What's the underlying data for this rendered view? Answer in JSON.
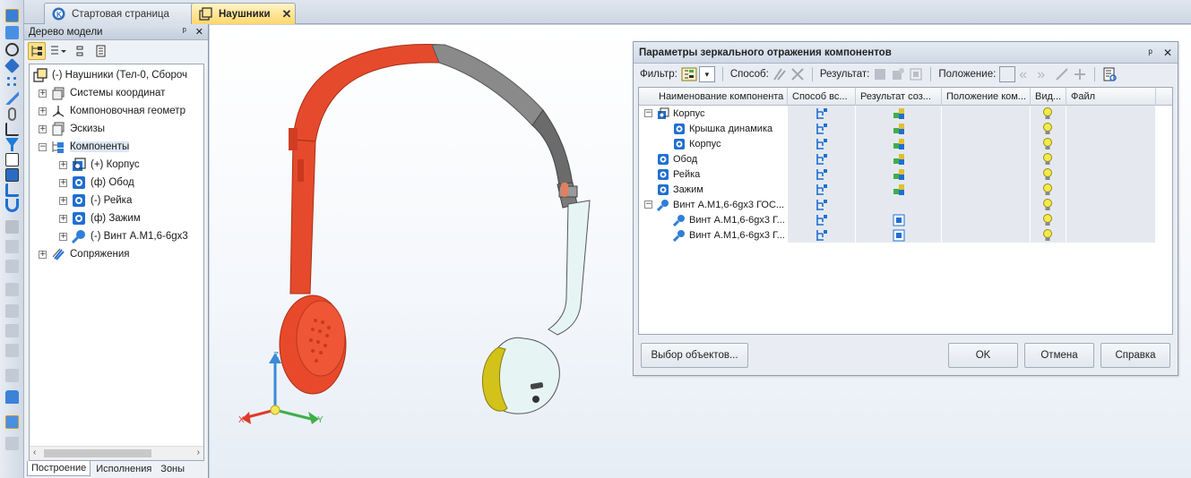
{
  "tabs": [
    {
      "label": "Стартовая страница",
      "icon": "kompas-logo-icon",
      "active": false
    },
    {
      "label": "Наушники",
      "icon": "assembly-icon",
      "active": true,
      "close": "✕"
    }
  ],
  "tree_panel": {
    "title": "Дерево модели",
    "pin": "ᵖ",
    "close": "✕",
    "nodes": [
      {
        "label": "(-) Наушники (Тел-0, Сбороч",
        "icon": "assembly-icon",
        "expander": ""
      },
      {
        "label": "Системы координат",
        "icon": "coordinate-systems-icon",
        "expander": "+"
      },
      {
        "label": "Компоновочная геометр",
        "icon": "layout-geometry-icon",
        "expander": "+"
      },
      {
        "label": "Эскизы",
        "icon": "sketches-icon",
        "expander": "+"
      },
      {
        "label": "Компоненты",
        "icon": "components-icon",
        "expander": "−"
      },
      {
        "label": "(+) Корпус",
        "icon": "subassembly-icon",
        "expander": "+"
      },
      {
        "label": "(ф) Обод",
        "icon": "part-icon",
        "expander": "+"
      },
      {
        "label": "(-) Рейка",
        "icon": "part-icon",
        "expander": "+"
      },
      {
        "label": "(ф) Зажим",
        "icon": "part-icon",
        "expander": "+"
      },
      {
        "label": "(-) Винт А.М1,6-6gx3",
        "icon": "screw-icon",
        "expander": "+"
      },
      {
        "label": "Сопряжения",
        "icon": "mates-icon",
        "expander": "+"
      }
    ],
    "bottom_tabs": [
      "Построение",
      "Исполнения",
      "Зоны"
    ]
  },
  "axes": {
    "x": "X",
    "y": "Y",
    "z": "Z"
  },
  "dialog": {
    "title": "Параметры зеркального отражения компонентов",
    "pin": "ᵖ",
    "close": "✕",
    "filter_label": "Фильтр:",
    "method_label": "Способ:",
    "result_label": "Результат:",
    "position_label": "Положение:",
    "columns": [
      "Наименование компонента",
      "Способ вс...",
      "Результат соз...",
      "Положение ком...",
      "Вид...",
      "Файл"
    ],
    "rows": [
      {
        "name": "Корпус",
        "expander": "−",
        "indent": 0,
        "icon": "subassembly-icon",
        "result_icon": "mirror-copy-icon"
      },
      {
        "name": "Крышка динамика",
        "expander": "",
        "indent": 1,
        "icon": "part-icon",
        "result_icon": "mirror-copy-icon"
      },
      {
        "name": "Корпус",
        "expander": "",
        "indent": 1,
        "icon": "part-icon",
        "result_icon": "mirror-copy-icon"
      },
      {
        "name": "Обод",
        "expander": "",
        "indent": 0,
        "icon": "part-icon",
        "result_icon": "mirror-copy-icon"
      },
      {
        "name": "Рейка",
        "expander": "",
        "indent": 0,
        "icon": "part-icon",
        "result_icon": "mirror-copy-icon"
      },
      {
        "name": "Зажим",
        "expander": "",
        "indent": 0,
        "icon": "part-icon",
        "result_icon": "mirror-copy-icon"
      },
      {
        "name": "Винт А.М1,6-6gx3 ГОС...",
        "expander": "−",
        "indent": 0,
        "icon": "screw-icon",
        "result_icon": ""
      },
      {
        "name": "Винт А.М1,6-6gx3 Г...",
        "expander": "",
        "indent": 1,
        "icon": "screw-icon",
        "result_icon": "instance-icon"
      },
      {
        "name": "Винт А.М1,6-6gx3 Г...",
        "expander": "",
        "indent": 1,
        "icon": "screw-icon",
        "result_icon": "instance-icon"
      }
    ],
    "buttons": {
      "select": "Выбор объектов...",
      "ok": "OK",
      "cancel": "Отмена",
      "help": "Справка"
    }
  },
  "colors": {
    "accent_orange": "#e84b2c",
    "dark_gray": "#6b6b6b",
    "light_cyan": "#e6f4f4",
    "yellow_rim": "#d2c21a",
    "blue_icon": "#1f6fd1"
  }
}
